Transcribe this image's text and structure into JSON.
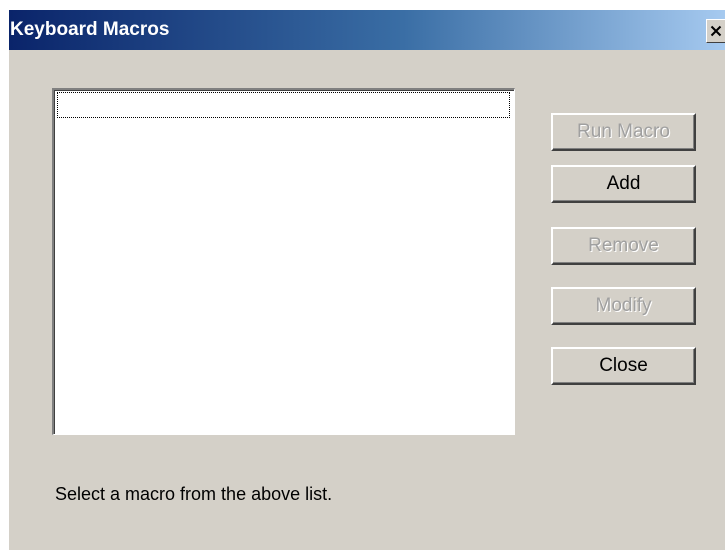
{
  "window": {
    "title": "Keyboard Macros",
    "close_symbol": "×"
  },
  "macro_list": {
    "items": []
  },
  "buttons": {
    "run_macro": {
      "label": "Run Macro",
      "enabled": false
    },
    "add": {
      "label": "Add",
      "enabled": true
    },
    "remove": {
      "label": "Remove",
      "enabled": false
    },
    "modify": {
      "label": "Modify",
      "enabled": false
    },
    "close": {
      "label": "Close",
      "enabled": true
    }
  },
  "status": {
    "message": "Select a macro from the above list."
  },
  "colors": {
    "dialog_background": "#d4d0c8",
    "titlebar_start": "#0a246a",
    "titlebar_end": "#a6caf0",
    "disabled_text": "#a0a0a0"
  },
  "icons": {
    "window_close": "close-icon"
  }
}
